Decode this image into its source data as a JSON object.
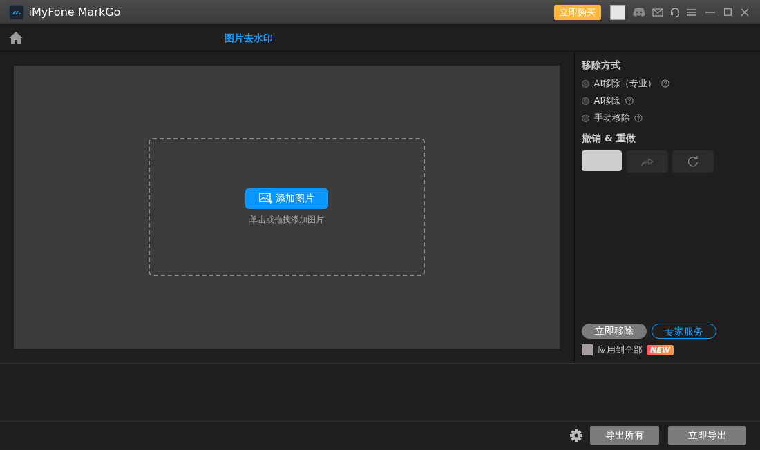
{
  "window": {
    "title": "iMyFone MarkGo",
    "buy_button": "立即购买"
  },
  "nav": {
    "page_title": "图片去水印"
  },
  "canvas": {
    "add_button": "添加图片",
    "hint": "单击或拖拽添加图片"
  },
  "removal": {
    "heading": "移除方式",
    "options": [
      {
        "label": "AI移除（专业）",
        "selected": false
      },
      {
        "label": "AI移除",
        "selected": false
      },
      {
        "label": "手动移除",
        "selected": false
      }
    ]
  },
  "undo_redo": {
    "heading": "撤销 & 重做"
  },
  "actions": {
    "remove_now": "立即移除",
    "expert_service": "专家服务",
    "apply_all": {
      "label": "应用到全部",
      "checked": false
    },
    "new_badge": "NEW"
  },
  "footer": {
    "buttons": [
      "导出所有",
      "立即导出"
    ]
  }
}
